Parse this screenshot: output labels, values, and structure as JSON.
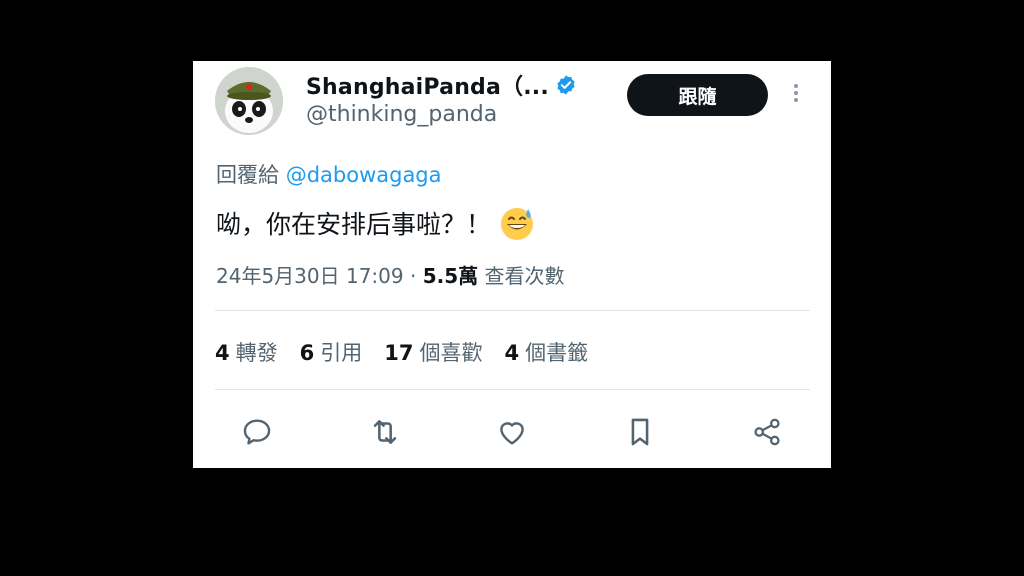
{
  "author": {
    "display_name": "ShanghaiPanda（...",
    "handle": "@thinking_panda",
    "verified_icon": "verified-badge-icon"
  },
  "follow_label": "跟隨",
  "reply_prefix": "回覆給",
  "reply_to": "@dabowagaga",
  "tweet_text": "呦，你在安排后事啦？！",
  "timestamp": "24年5月30日 17:09",
  "separator": " · ",
  "views_count": "5.5萬",
  "views_label": "查看次數",
  "stats": [
    {
      "num": "4",
      "label": "轉發"
    },
    {
      "num": "6",
      "label": "引用"
    },
    {
      "num": "17",
      "label": "個喜歡"
    },
    {
      "num": "4",
      "label": "個書籤"
    }
  ],
  "icons": [
    "reply-icon",
    "retweet-icon",
    "like-icon",
    "bookmark-icon",
    "share-icon"
  ],
  "colors": {
    "accent": "#1d9bf0",
    "text": "#0f1419",
    "muted": "#536471",
    "button": "#0f1419"
  }
}
